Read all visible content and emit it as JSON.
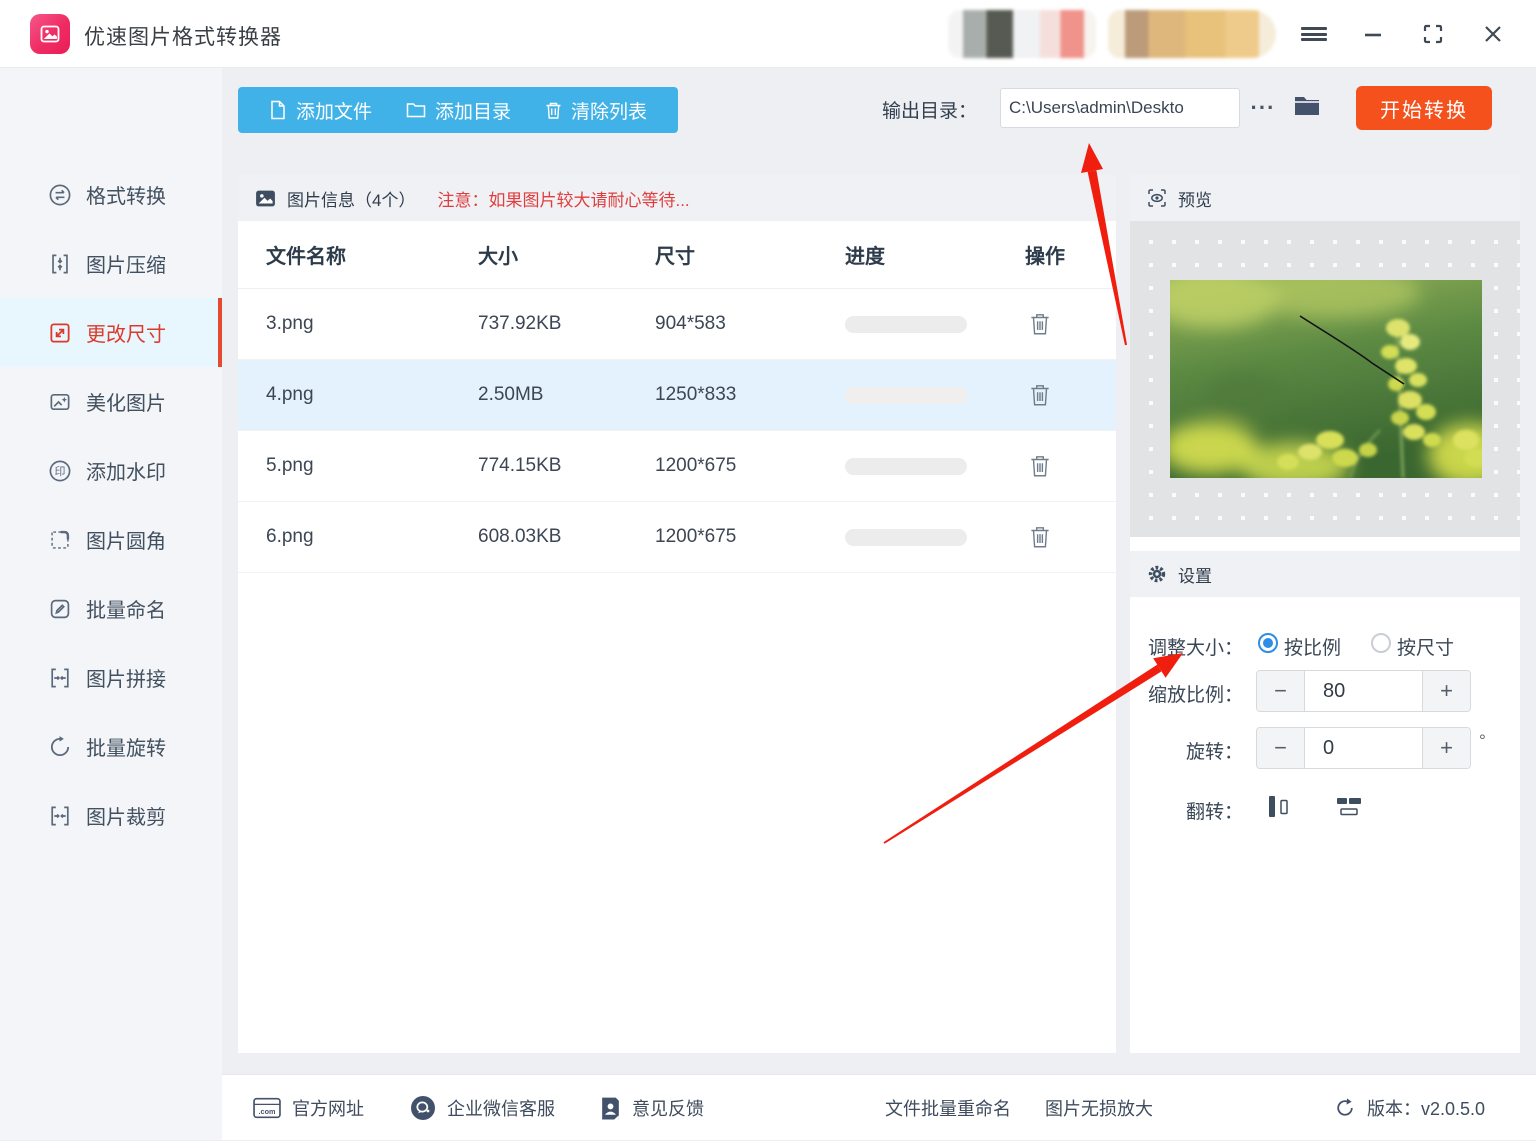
{
  "titlebar": {
    "app_title": "优速图片格式转换器"
  },
  "sidebar": {
    "items": [
      {
        "label": "格式转换"
      },
      {
        "label": "图片压缩"
      },
      {
        "label": "更改尺寸",
        "active": true
      },
      {
        "label": "美化图片"
      },
      {
        "label": "添加水印"
      },
      {
        "label": "图片圆角"
      },
      {
        "label": "批量命名"
      },
      {
        "label": "图片拼接"
      },
      {
        "label": "批量旋转"
      },
      {
        "label": "图片裁剪"
      }
    ]
  },
  "toolbar": {
    "add_file": "添加文件",
    "add_dir": "添加目录",
    "clear_list": "清除列表",
    "output_label": "输出目录：",
    "output_path": "C:\\Users\\admin\\Deskto",
    "more": "···",
    "start": "开始转换"
  },
  "table": {
    "panel_title": "图片信息（4个）",
    "notice": "注意：如果图片较大请耐心等待...",
    "columns": [
      "文件名称",
      "大小",
      "尺寸",
      "进度",
      "操作"
    ],
    "rows": [
      {
        "name": "3.png",
        "size": "737.92KB",
        "dims": "904*583"
      },
      {
        "name": "4.png",
        "size": "2.50MB",
        "dims": "1250*833",
        "selected": true
      },
      {
        "name": "5.png",
        "size": "774.15KB",
        "dims": "1200*675"
      },
      {
        "name": "6.png",
        "size": "608.03KB",
        "dims": "1200*675"
      }
    ]
  },
  "preview": {
    "title": "预览"
  },
  "settings": {
    "title": "设置",
    "resize_label": "调整大小：",
    "radio_ratio": "按比例",
    "radio_size": "按尺寸",
    "scale_label": "缩放比例：",
    "scale_value": "80",
    "rotate_label": "旋转：",
    "rotate_value": "0",
    "degree": "°",
    "flip_label": "翻转：",
    "minus": "−",
    "plus": "+"
  },
  "footer": {
    "website": "官方网址",
    "wechat_service": "企业微信客服",
    "feedback": "意见反馈",
    "batch_rename": "文件批量重命名",
    "lossless_enlarge": "图片无损放大",
    "version": "版本：v2.0.5.0"
  },
  "colors": {
    "accent_blue": "#41b2e8",
    "accent_orange": "#f4511d",
    "active_red": "#dd3a2a",
    "notice_red": "#e03e3e",
    "arrow_red": "#f01e0e",
    "row_highlight": "#e3f2fc"
  }
}
